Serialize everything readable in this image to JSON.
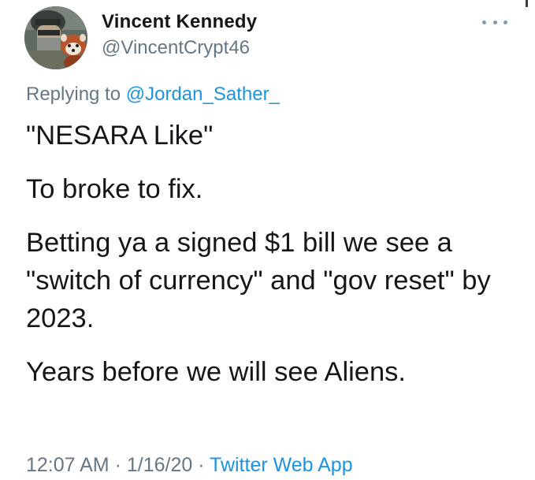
{
  "author": {
    "display_name": "Vincent Kennedy",
    "handle": "@VincentCrypt46"
  },
  "reply": {
    "prefix": "Replying to ",
    "mention": "@Jordan_Sather_"
  },
  "tweet": {
    "paragraphs": [
      "\"NESARA Like\"",
      "To broke to fix.",
      "Betting ya a signed $1 bill we see a \"switch of currency\" and \"gov reset\" by 2023.",
      "Years before we will see Aliens."
    ]
  },
  "meta": {
    "time": "12:07 AM",
    "sep1": " · ",
    "date": "1/16/20",
    "sep2": " · ",
    "source": "Twitter Web App"
  },
  "icons": {
    "more": "more-horizontal-icon",
    "avatar": "profile-avatar"
  },
  "colors": {
    "link": "#1b95e0",
    "muted": "#657786",
    "text": "#14171a"
  }
}
